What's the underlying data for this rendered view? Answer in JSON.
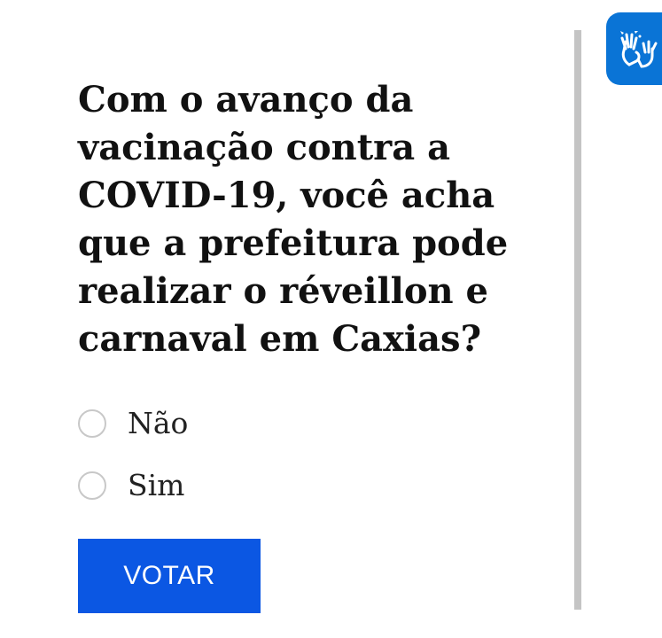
{
  "poll": {
    "question": "Com o avanço da vacinação contra a COVID-19, você acha que a prefeitura pode realizar o réveillon e carnaval em Caxias?",
    "options": [
      {
        "label": "Não",
        "selected": false
      },
      {
        "label": "Sim",
        "selected": false
      }
    ],
    "submit_label": "VOTAR"
  },
  "accessibility_widget": {
    "icon": "sign-language-hands-icon",
    "color": "#0a74d6"
  },
  "colors": {
    "button": "#0b57e3",
    "divider": "#c4c4c4"
  }
}
